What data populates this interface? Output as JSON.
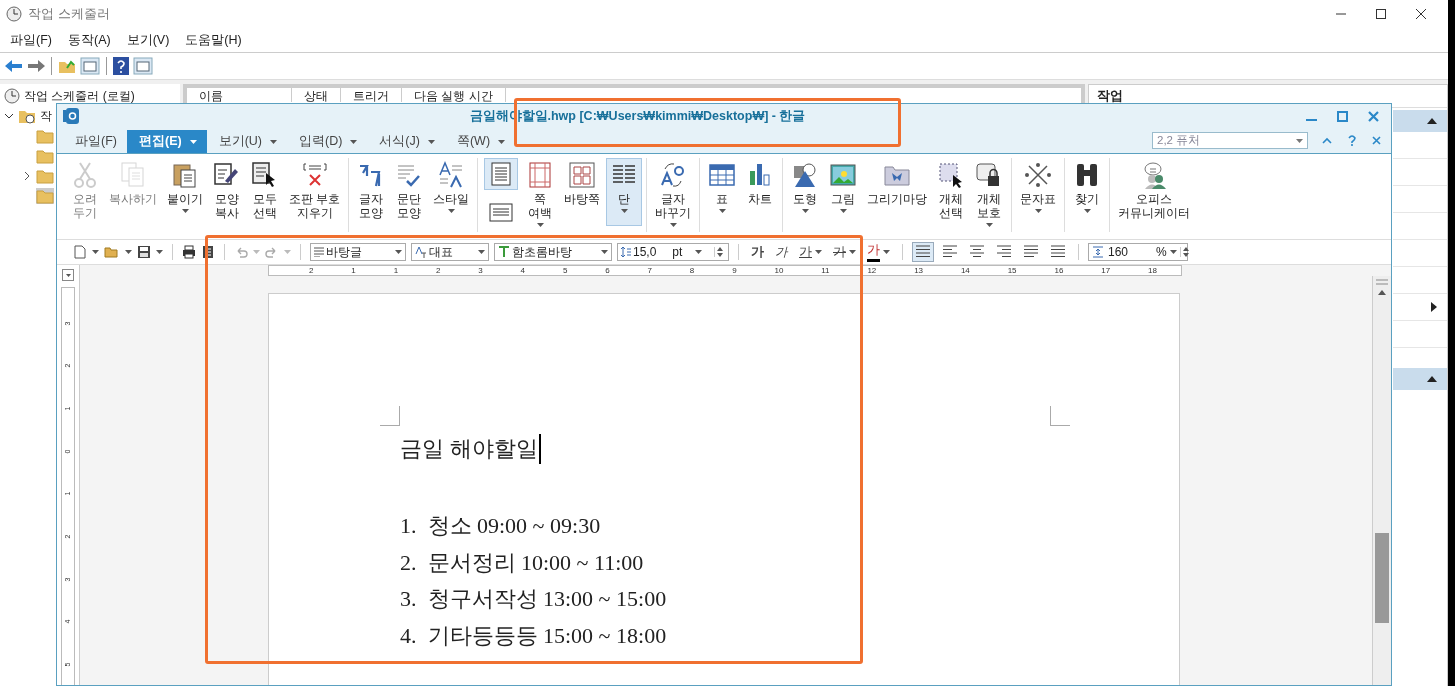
{
  "scheduler": {
    "title": "작업 스케줄러",
    "menu": [
      "파일(F)",
      "동작(A)",
      "보기(V)",
      "도움말(H)"
    ],
    "tree": {
      "label": "작업 스케줄러 (로컬)",
      "children": [
        {
          "label": "작",
          "expanded": true,
          "children": [
            {
              "expandable": false,
              "selected": false
            },
            {
              "expandable": false,
              "selected": false
            },
            {
              "expandable": true,
              "selected": false
            },
            {
              "expandable": false,
              "selected": true
            }
          ]
        }
      ]
    },
    "columns": [
      "이름",
      "상태",
      "트리거",
      "다음 실행 시간"
    ],
    "actions_title": "작업"
  },
  "hwp": {
    "title": "금일해야할일.hwp [C:₩Users₩kimmi₩Desktop₩] - 한글",
    "menu": [
      {
        "label": "파일(F)",
        "selected": false,
        "dropdown": false
      },
      {
        "label": "편집(E)",
        "selected": true,
        "dropdown": true
      },
      {
        "label": "보기(U)",
        "selected": false,
        "dropdown": true
      },
      {
        "label": "입력(D)",
        "selected": false,
        "dropdown": true
      },
      {
        "label": "서식(J)",
        "selected": false,
        "dropdown": true
      },
      {
        "label": "쪽(W)",
        "selected": false,
        "dropdown": true
      }
    ],
    "search": {
      "value": "2,2 퓨처"
    },
    "ribbon": [
      [
        {
          "kind": "large",
          "label": "오려\n두기",
          "disabled": true,
          "dropdown": false,
          "selected": false
        },
        {
          "kind": "large",
          "label": "복사하기",
          "disabled": true,
          "dropdown": false,
          "selected": false
        },
        {
          "kind": "large",
          "label": "붙이기",
          "disabled": false,
          "dropdown": true,
          "selected": false
        },
        {
          "kind": "large",
          "label": "모양\n복사",
          "disabled": false,
          "dropdown": false,
          "selected": false
        },
        {
          "kind": "large",
          "label": "모두\n선택",
          "disabled": false,
          "dropdown": false,
          "selected": false
        },
        {
          "kind": "large",
          "label": "조판 부호\n지우기",
          "disabled": false,
          "dropdown": false,
          "selected": false
        }
      ],
      [
        {
          "kind": "large",
          "label": "글자\n모양",
          "disabled": false,
          "dropdown": false,
          "selected": false
        },
        {
          "kind": "large",
          "label": "문단\n모양",
          "disabled": false,
          "dropdown": false,
          "selected": false
        },
        {
          "kind": "large",
          "label": "스타일",
          "disabled": false,
          "dropdown": true,
          "selected": false
        }
      ],
      [
        {
          "kind": "stack",
          "disabled": false,
          "dropdown": false,
          "selected": true
        },
        {
          "kind": "large",
          "label": "쪽\n여백",
          "disabled": false,
          "dropdown": true,
          "selected": false
        },
        {
          "kind": "large",
          "label": "바탕쪽",
          "disabled": false,
          "dropdown": false,
          "selected": false
        },
        {
          "kind": "large",
          "label": "단",
          "disabled": false,
          "dropdown": true,
          "selected": true
        }
      ],
      [
        {
          "kind": "large",
          "label": "글자\n바꾸기",
          "disabled": false,
          "dropdown": true,
          "selected": false
        }
      ],
      [
        {
          "kind": "large",
          "label": "표",
          "disabled": false,
          "dropdown": true,
          "selected": false
        },
        {
          "kind": "large",
          "label": "차트",
          "disabled": false,
          "dropdown": false,
          "selected": false
        }
      ],
      [
        {
          "kind": "large",
          "label": "도형",
          "disabled": false,
          "dropdown": true,
          "selected": false
        },
        {
          "kind": "large",
          "label": "그림",
          "disabled": false,
          "dropdown": true,
          "selected": false
        },
        {
          "kind": "large",
          "label": "그리기마당",
          "disabled": false,
          "dropdown": false,
          "selected": false
        },
        {
          "kind": "large",
          "label": "개체\n선택",
          "disabled": false,
          "dropdown": false,
          "selected": false
        },
        {
          "kind": "large",
          "label": "개체\n보호",
          "disabled": false,
          "dropdown": true,
          "selected": false
        }
      ],
      [
        {
          "kind": "large",
          "label": "문자표",
          "disabled": false,
          "dropdown": true,
          "selected": false
        }
      ],
      [
        {
          "kind": "large",
          "label": "찾기",
          "disabled": false,
          "dropdown": true,
          "selected": false
        }
      ],
      [
        {
          "kind": "large",
          "label": "오피스\n커뮤니케이터",
          "disabled": false,
          "dropdown": false,
          "selected": false
        }
      ]
    ],
    "format": {
      "style": "바탕글",
      "lang": "대표",
      "font": "함초롬바탕",
      "size": "15,0",
      "unit": "pt",
      "char_buttons": [
        {
          "kind": "bold",
          "label": "가"
        },
        {
          "kind": "italic",
          "label": "가"
        },
        {
          "kind": "underline",
          "label": "가"
        },
        {
          "kind": "strike",
          "label": "가"
        },
        {
          "kind": "color",
          "label": "가"
        }
      ],
      "align": [
        {
          "selected": true
        },
        {
          "selected": false
        },
        {
          "selected": false
        },
        {
          "selected": false
        },
        {
          "selected": false
        },
        {
          "selected": false
        }
      ],
      "line_spacing": "160",
      "spacing_unit": "%"
    },
    "ruler_h": [
      "2",
      "1",
      "1",
      "2",
      "3",
      "4",
      "5",
      "6",
      "7",
      "8",
      "9",
      "10",
      "11",
      "12",
      "13",
      "14",
      "15",
      "16",
      "17",
      "18"
    ],
    "ruler_v": [
      "3",
      "2",
      "1",
      "0",
      "1",
      "2",
      "3",
      "4",
      "5"
    ],
    "document": {
      "heading": "금일 해야할일",
      "items": [
        "1.  청소 09:00 ~ 09:30",
        "2.  문서정리 10:00 ~ 11:00",
        "3.  청구서작성 13:00 ~ 15:00",
        "4.  기타등등등 15:00 ~ 18:00"
      ]
    }
  }
}
